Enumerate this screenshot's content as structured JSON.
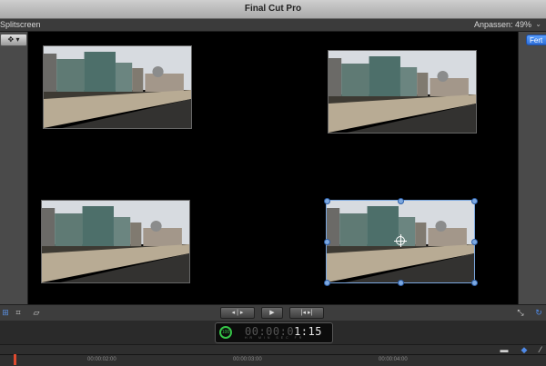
{
  "app": {
    "title": "Final Cut Pro"
  },
  "viewer": {
    "effect_label": "Splitscreen",
    "zoom_label": "Anpassen:",
    "zoom_value": "49%",
    "done_label": "Fert"
  },
  "timecode": {
    "dim": "00:00:0",
    "bright": "1:15",
    "units": "HR MIN SEC FR"
  },
  "ruler": {
    "ticks": [
      "00:00:02:00",
      "00:00:03:00",
      "00:00:04:00"
    ]
  },
  "icons": {
    "tool": "transform-tool-icon",
    "crop": "crop-icon",
    "distort": "distort-icon",
    "play": "play-icon",
    "fullscreen": "fullscreen-icon",
    "reset": "reset-icon"
  },
  "colors": {
    "done_accent": "#2f6fd8",
    "timecode_ring": "#36c448",
    "playhead": "#e04a2f"
  }
}
